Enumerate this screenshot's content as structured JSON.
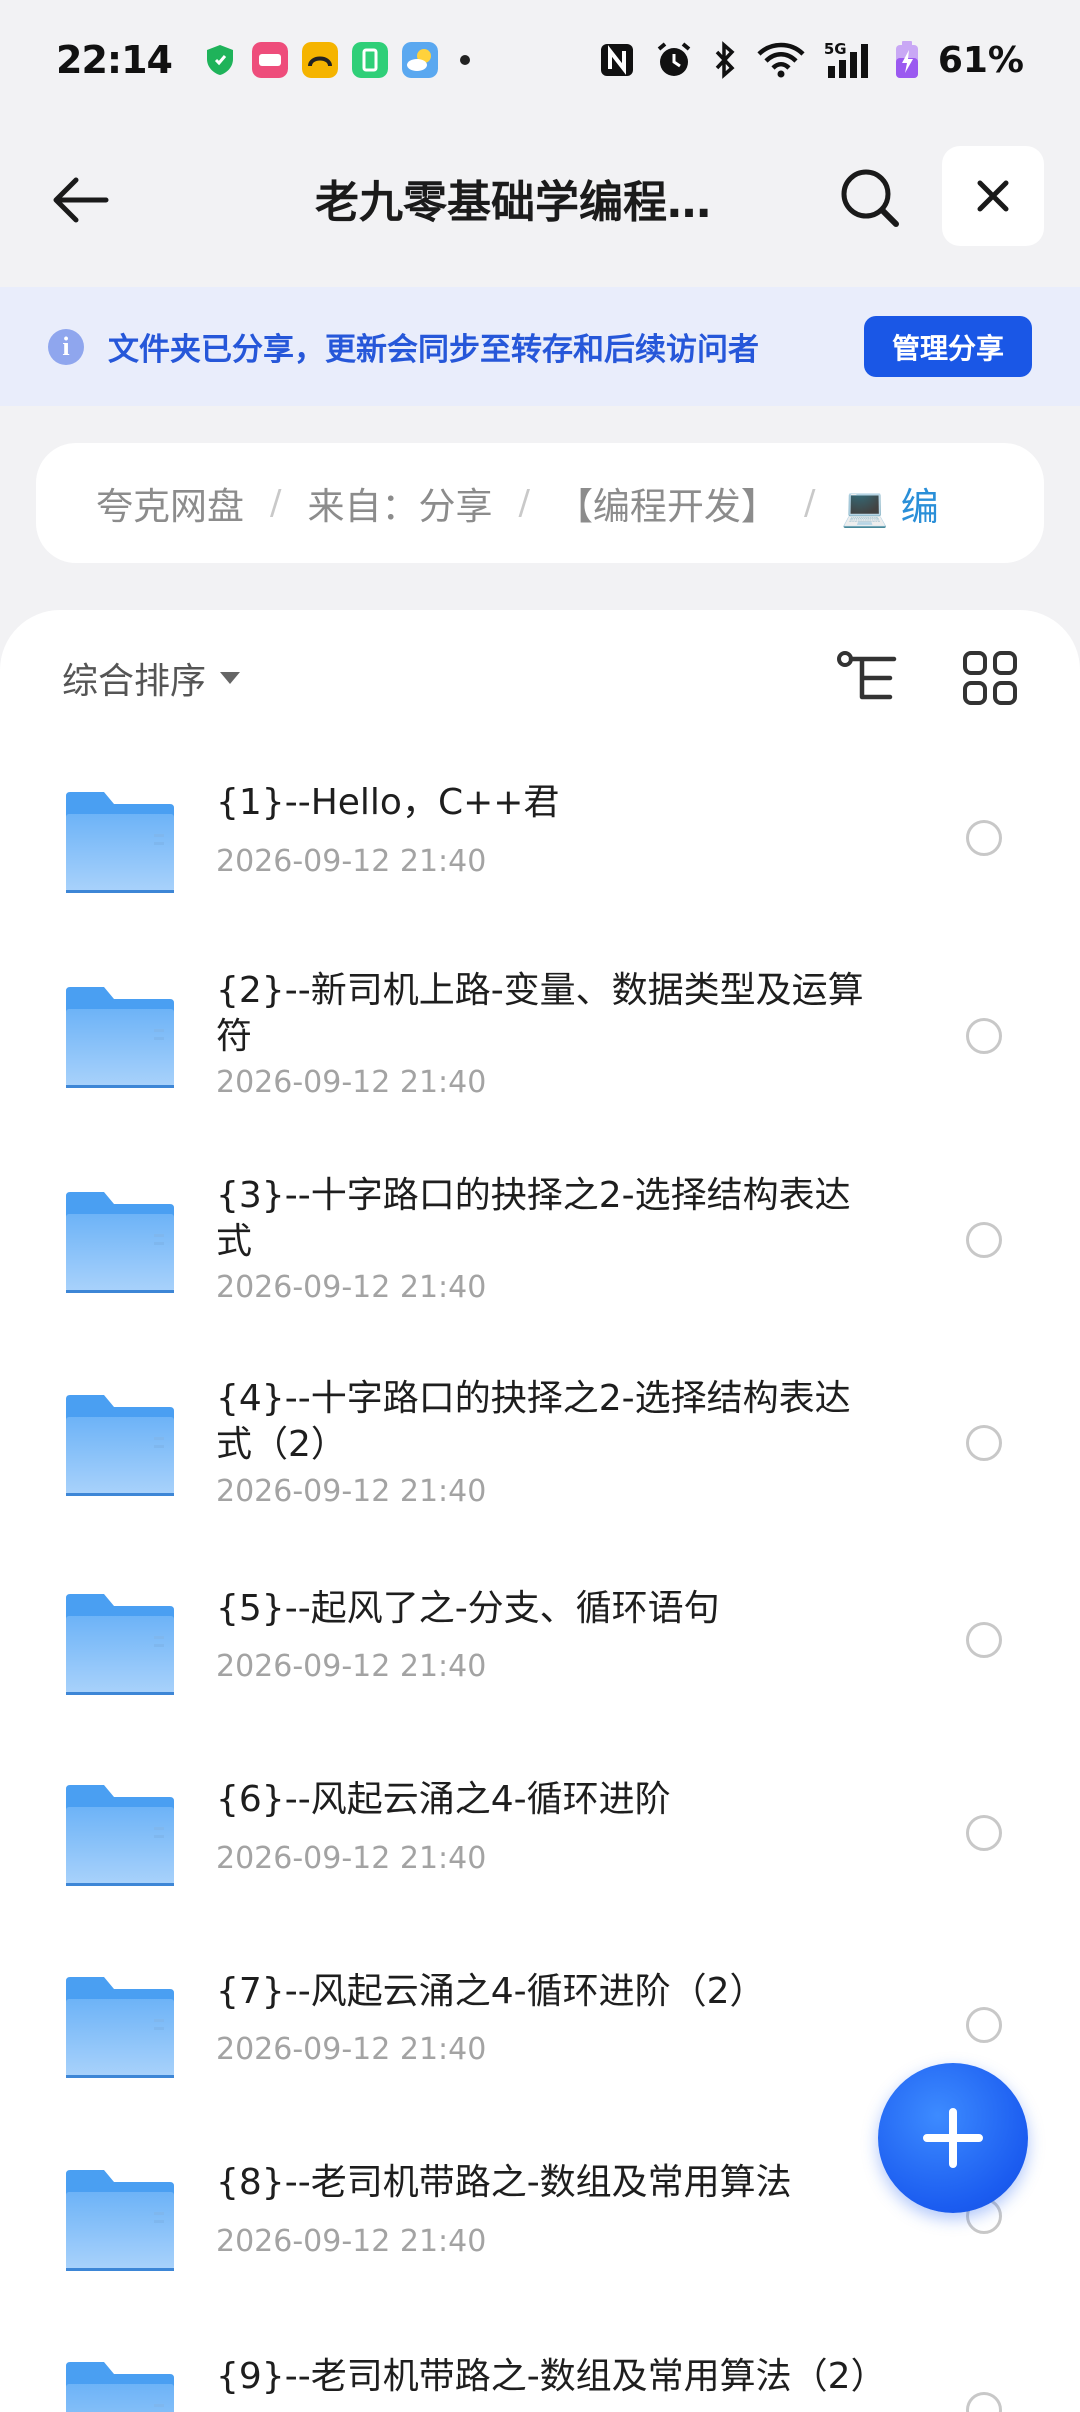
{
  "status_bar": {
    "time": "22:14",
    "network": "5G",
    "battery": "61%"
  },
  "header": {
    "title": "老九零基础学编程…"
  },
  "banner": {
    "text": "文件夹已分享，更新会同步至转存和后续访问者",
    "button_label": "管理分享"
  },
  "breadcrumb": {
    "items": [
      "夸克网盘",
      "来自：分享",
      "【编程开发】",
      "💻 编"
    ],
    "separator": "/"
  },
  "toolbar": {
    "sort_label": "综合排序"
  },
  "files": [
    {
      "name": "{1}--Hello，C++君",
      "date": "2026-09-12 21:40"
    },
    {
      "name": "{2}--新司机上路-变量、数据类型及运算符",
      "date": "2026-09-12 21:40"
    },
    {
      "name": "{3}--十字路口的抉择之2-选择结构表达式",
      "date": "2026-09-12 21:40"
    },
    {
      "name": "{4}--十字路口的抉择之2-选择结构表达式（2）",
      "date": "2026-09-12 21:40"
    },
    {
      "name": "{5}--起风了之-分支、循环语句",
      "date": "2026-09-12 21:40"
    },
    {
      "name": "{6}--风起云涌之4-循环进阶",
      "date": "2026-09-12 21:40"
    },
    {
      "name": "{7}--风起云涌之4-循环进阶（2）",
      "date": "2026-09-12 21:40"
    },
    {
      "name": "{8}--老司机带路之-数组及常用算法",
      "date": "2026-09-12 21:40"
    },
    {
      "name": "{9}--老司机带路之-数组及常用算法（2）",
      "date": ""
    }
  ],
  "colors": {
    "accent": "#1a57e6",
    "banner_bg": "#e9edfb",
    "banner_text": "#2657d9",
    "folder": "#6fb1f5"
  }
}
